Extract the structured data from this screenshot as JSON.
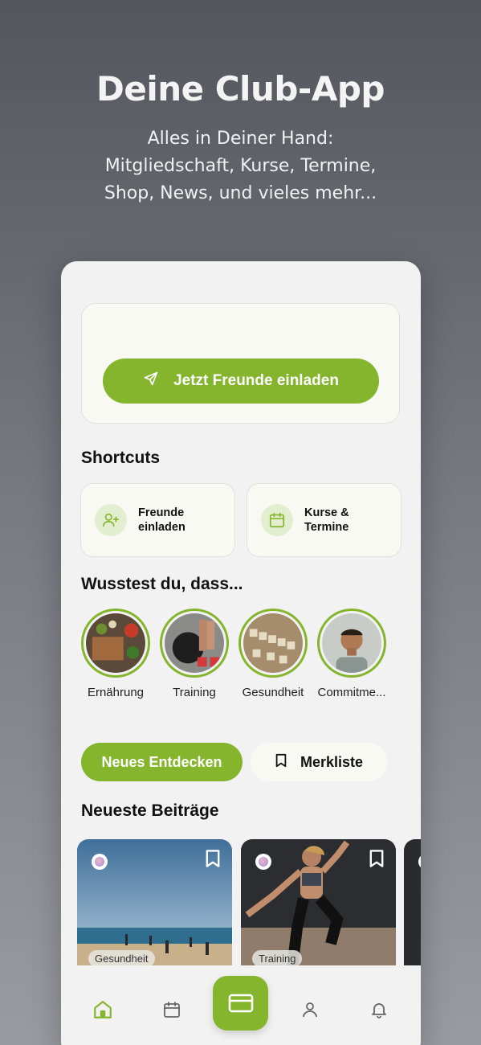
{
  "hero": {
    "title": "Deine Club-App",
    "subtitle_lines": [
      "Alles in Deiner Hand:",
      "Mitgliedschaft, Kurse, Termine,",
      "Shop, News, und vieles mehr..."
    ]
  },
  "invite": {
    "button_label": "Jetzt Freunde einladen",
    "icon": "send-icon"
  },
  "shortcuts": {
    "title": "Shortcuts",
    "items": [
      {
        "label": "Freunde einladen",
        "icon": "user-plus-icon"
      },
      {
        "label": "Kurse & Termine",
        "icon": "calendar-icon"
      }
    ]
  },
  "stories": {
    "title": "Wusstest du, dass...",
    "items": [
      {
        "label": "Ernährung"
      },
      {
        "label": "Training"
      },
      {
        "label": "Gesundheit"
      },
      {
        "label": "Commitme..."
      }
    ]
  },
  "tabs": {
    "active_label": "Neues Entdecken",
    "inactive_label": "Merkliste"
  },
  "posts": {
    "title": "Neueste Beiträge",
    "items": [
      {
        "tag": "Gesundheit"
      },
      {
        "tag": "Training"
      }
    ]
  },
  "nav": {
    "items": [
      "home-icon",
      "calendar-icon",
      "card-icon",
      "profile-icon",
      "bell-icon"
    ],
    "accent": "#84b52c"
  }
}
